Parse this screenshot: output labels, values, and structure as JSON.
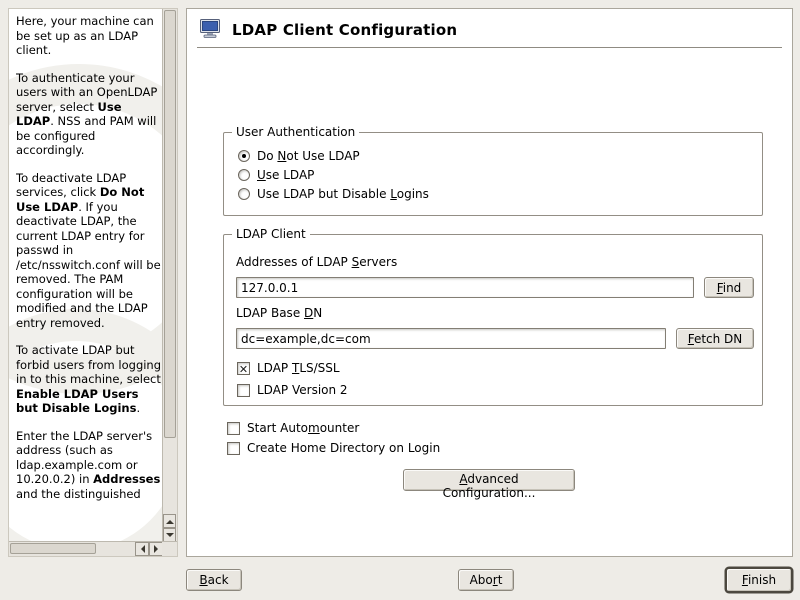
{
  "header": {
    "title": "LDAP Client Configuration"
  },
  "help": {
    "paragraphs": [
      "Here, your machine can be set up as an LDAP client.",
      "To authenticate your users with an OpenLDAP server, select **Use LDAP**. NSS and PAM will be configured accordingly.",
      "To deactivate LDAP services, click **Do Not Use LDAP**. If you deactivate LDAP, the current LDAP entry for passwd in /etc/nsswitch.conf will be removed. The PAM configuration will be modified and the LDAP entry removed.",
      "To activate LDAP but forbid users from logging in to this machine, select **Enable LDAP Users but Disable Logins**.",
      "Enter the LDAP server's address (such as ldap.example.com or 10.20.0.2) in **Addresses** and the distinguished"
    ]
  },
  "auth": {
    "legend": "User Authentication",
    "options": [
      {
        "label": "Do &Not Use LDAP",
        "selected": true
      },
      {
        "label": "&Use LDAP",
        "selected": false
      },
      {
        "label": "Use LDAP but Disable &Logins",
        "selected": false
      }
    ]
  },
  "client": {
    "legend": "LDAP Client",
    "servers": {
      "label": "Addresses of LDAP &Servers",
      "value": "127.0.0.1",
      "find_button": "&Find"
    },
    "base_dn": {
      "label": "LDAP Base &DN",
      "value": "dc=example,dc=com",
      "fetch_button": "&Fetch DN"
    },
    "tls": {
      "label": "LDAP &TLS/SSL",
      "checked": true
    },
    "version2": {
      "label": "LDAP Version 2",
      "checked": false
    }
  },
  "options": {
    "automounter": {
      "label": "Start Auto&mounter",
      "checked": false
    },
    "home_dir": {
      "label": "Create Home Directory on Login",
      "checked": false
    }
  },
  "advanced_button": "&Advanced Configuration...",
  "footer": {
    "back_button": "&Back",
    "abort_button": "Abo&rt",
    "finish_button": "&Finish"
  },
  "icons": {
    "header": "computer-icon"
  },
  "colors": {
    "screen_blue": "#3b5fae",
    "window_bg": "#eeece7"
  }
}
